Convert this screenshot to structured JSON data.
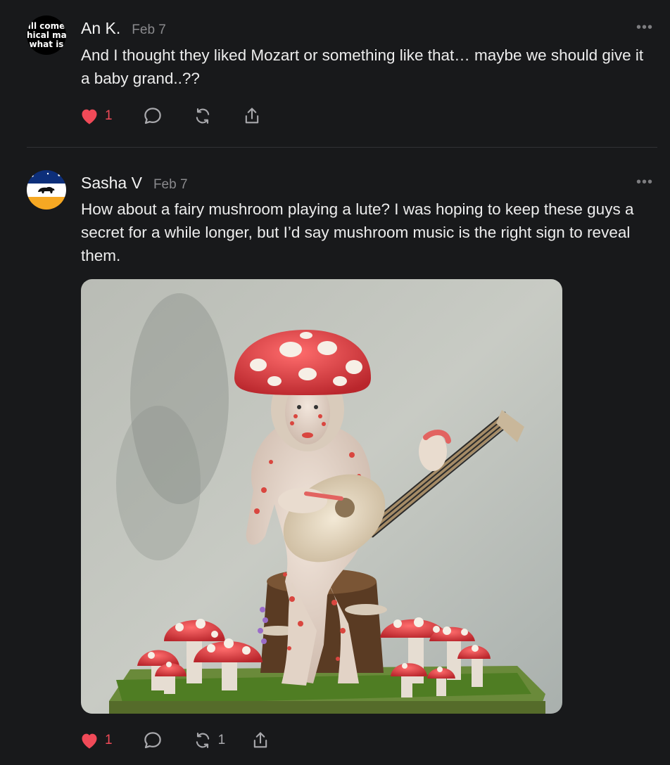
{
  "posts": [
    {
      "author": "An K.",
      "date": "Feb 7",
      "avatar_lines": [
        "ıll come",
        "hical ma",
        "what is"
      ],
      "text": "And I thought they liked Mozart or something like that… maybe we should give it a baby grand..??",
      "likes": "1",
      "reposts": "",
      "more": "•••"
    },
    {
      "author": "Sasha V",
      "date": "Feb 7",
      "text": "How about a fairy mushroom playing a lute? I was hoping to keep these guys a secret for a while longer, but I’d say mushroom music is the right sign to reveal them.",
      "image_subject": "mushroom fairy miniature playing a lute",
      "likes": "1",
      "reposts": "1",
      "more": "•••"
    }
  ],
  "colors": {
    "background": "#18191b",
    "like_red": "#f04a58",
    "icon_grey": "#a9a9ad",
    "divider": "#313235"
  }
}
